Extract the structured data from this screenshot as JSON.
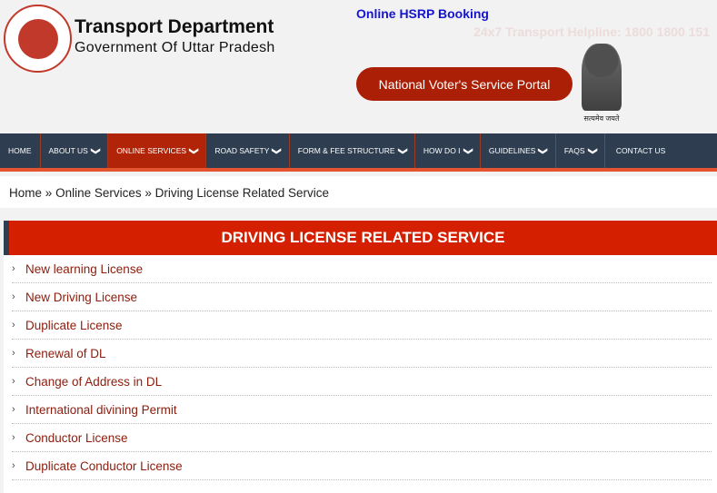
{
  "header": {
    "logo_text": "उत्तर प्रदेश सरकार परिवहन विभाग",
    "title": "Transport Department",
    "subtitle": "Government Of Uttar Pradesh",
    "hsrp_link": "Online HSRP Booking",
    "helpline": "24x7 Transport Helpline: 1800 1800 151",
    "voter_button": "National Voter's Service Portal",
    "emblem_motto": "सत्यमेव जयते"
  },
  "nav": {
    "items": [
      {
        "label": "HOME"
      },
      {
        "label": "ABOUT US",
        "dropdown": true
      },
      {
        "label": "ONLINE SERVICES",
        "dropdown": true,
        "active": true
      },
      {
        "label": "ROAD SAFETY",
        "dropdown": true
      },
      {
        "label": "FORM & FEE STRUCTURE",
        "dropdown": true
      },
      {
        "label": "HOW DO I",
        "dropdown": true
      },
      {
        "label": "GUIDELINES",
        "dropdown": true
      },
      {
        "label": "FAQS",
        "dropdown": true
      },
      {
        "label": "CONTACT US"
      }
    ]
  },
  "breadcrumb": {
    "items": [
      "Home",
      "Online Services",
      "Driving License Related Service"
    ],
    "separator": "»"
  },
  "panel": {
    "title": "DRIVING LICENSE RELATED SERVICE",
    "items": [
      "New learning License",
      "New Driving License",
      "Duplicate License",
      "Renewal of DL",
      "Change of Address in DL",
      "International divining Permit",
      "Conductor License",
      "Duplicate Conductor License"
    ]
  },
  "colors": {
    "nav_bg": "#2e3e50",
    "accent_red": "#d42000",
    "active_nav": "#b12407",
    "link": "#8c1c0c",
    "hsrp": "#1515d0"
  }
}
